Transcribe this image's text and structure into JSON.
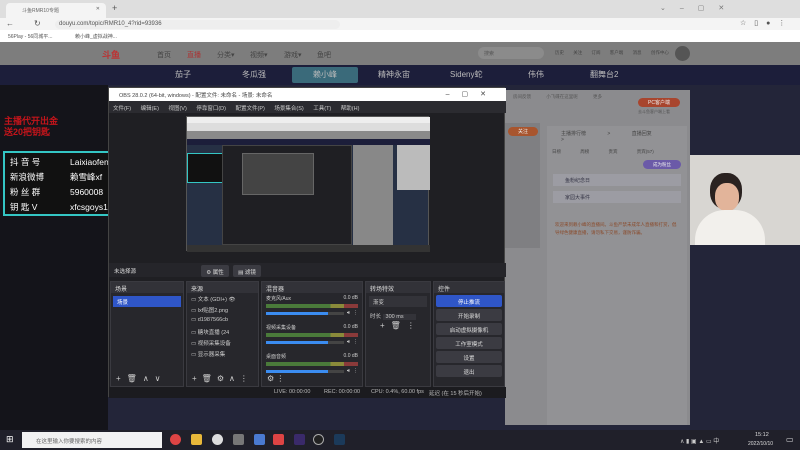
{
  "browser": {
    "tab_title": "斗鱼RMR10专题",
    "url": "douyu.com/topic/RMR10_4?rid=93936",
    "bookmarks": [
      "56Play - 56同城平...",
      "赖小峰_虚拟战神..."
    ]
  },
  "douyu": {
    "logo": "斗鱼",
    "nav": [
      "首页",
      "直播",
      "分类▾",
      "视频▾",
      "游戏▾",
      "鱼吧"
    ],
    "search_placeholder": "搜索",
    "header_icons": [
      "历史",
      "关注",
      "订阅",
      "客户端",
      "消息",
      "创作中心"
    ],
    "streamers": [
      "茄子",
      "冬瓜强",
      "赖小峰",
      "精神永宙",
      "Sideny蛇",
      "伟伟",
      "翻舞台2"
    ],
    "panel": {
      "actions": [
        "房间反馈",
        "小飞碟在这里呢",
        "更多"
      ],
      "client_btn": "PC客户端",
      "client_sub": "去斗鱼客户端上看",
      "follow": "关注",
      "rank_btn": "主播排行榜 >",
      "gift_btn": "直播回复 >",
      "tabs": [
        "日榜",
        "周榜",
        "贵宾",
        "贵宾(57)"
      ],
      "fans_btn": "成为粉丝",
      "events": [
        "鱼粉纪念日",
        "家园大事件"
      ],
      "notice": "欢迎来到赖小峰的直播间。斗鱼严禁未成年人直播和打赏，倡导绿色健康直播，请勿私下交易，谨防诈骗。"
    }
  },
  "overlay": {
    "promo": [
      "主播代开出金",
      "送20把钥匙"
    ],
    "info": [
      [
        "抖 音 号",
        "Laixiaofeng"
      ],
      [
        "新浪微博",
        "赖雪峰xf"
      ],
      [
        "粉 丝 群",
        "5960008"
      ],
      [
        "钥 匙 V",
        "xfcsgoys1"
      ]
    ]
  },
  "obs": {
    "title": "OBS 28.0.2 (64-bit, windows) - 配置文件: 未命名 - 场景: 未命名",
    "menu": [
      "文件(F)",
      "编辑(E)",
      "视图(V)",
      "停靠窗口(D)",
      "配置文件(P)",
      "场景集合(S)",
      "工具(T)",
      "帮助(H)"
    ],
    "no_source": "未选择源",
    "properties": "属性",
    "filters": "滤镜",
    "scenes": {
      "title": "场景",
      "items": [
        "场景"
      ]
    },
    "sources": {
      "title": "来源",
      "items": [
        "文本 (GDI+)",
        "lxf贴图2.png",
        "d1987566cb",
        "糖块直播 (24",
        "视频采集设备",
        "显示器采集"
      ]
    },
    "mixer": {
      "title": "混音器",
      "channels": [
        {
          "name": "麦克风/Aux",
          "db": "0.0 dB",
          "level": 0.8
        },
        {
          "name": "视频采集设备",
          "db": "0.0 dB",
          "level": 0.8
        },
        {
          "name": "桌面音频",
          "db": "0.0 dB",
          "level": 0.8
        }
      ]
    },
    "transitions": {
      "title": "转场特效",
      "type": "渐变",
      "duration_label": "时长",
      "duration": "300 ms"
    },
    "controls": {
      "title": "控件",
      "buttons": [
        "停止推流",
        "开始录制",
        "启动虚拟摄像机",
        "工作室模式",
        "设置",
        "退出"
      ]
    },
    "status": {
      "live": "LIVE: 00:00:00",
      "rec": "REC: 00:00:00",
      "cpu": "CPU: 0.4%, 60.00 fps",
      "delay": "延迟 (在 15 秒后开始)"
    }
  },
  "taskbar": {
    "search_placeholder": "在这里输入你要搜索的内容",
    "time": "15:12",
    "date": "2022/10/10"
  }
}
